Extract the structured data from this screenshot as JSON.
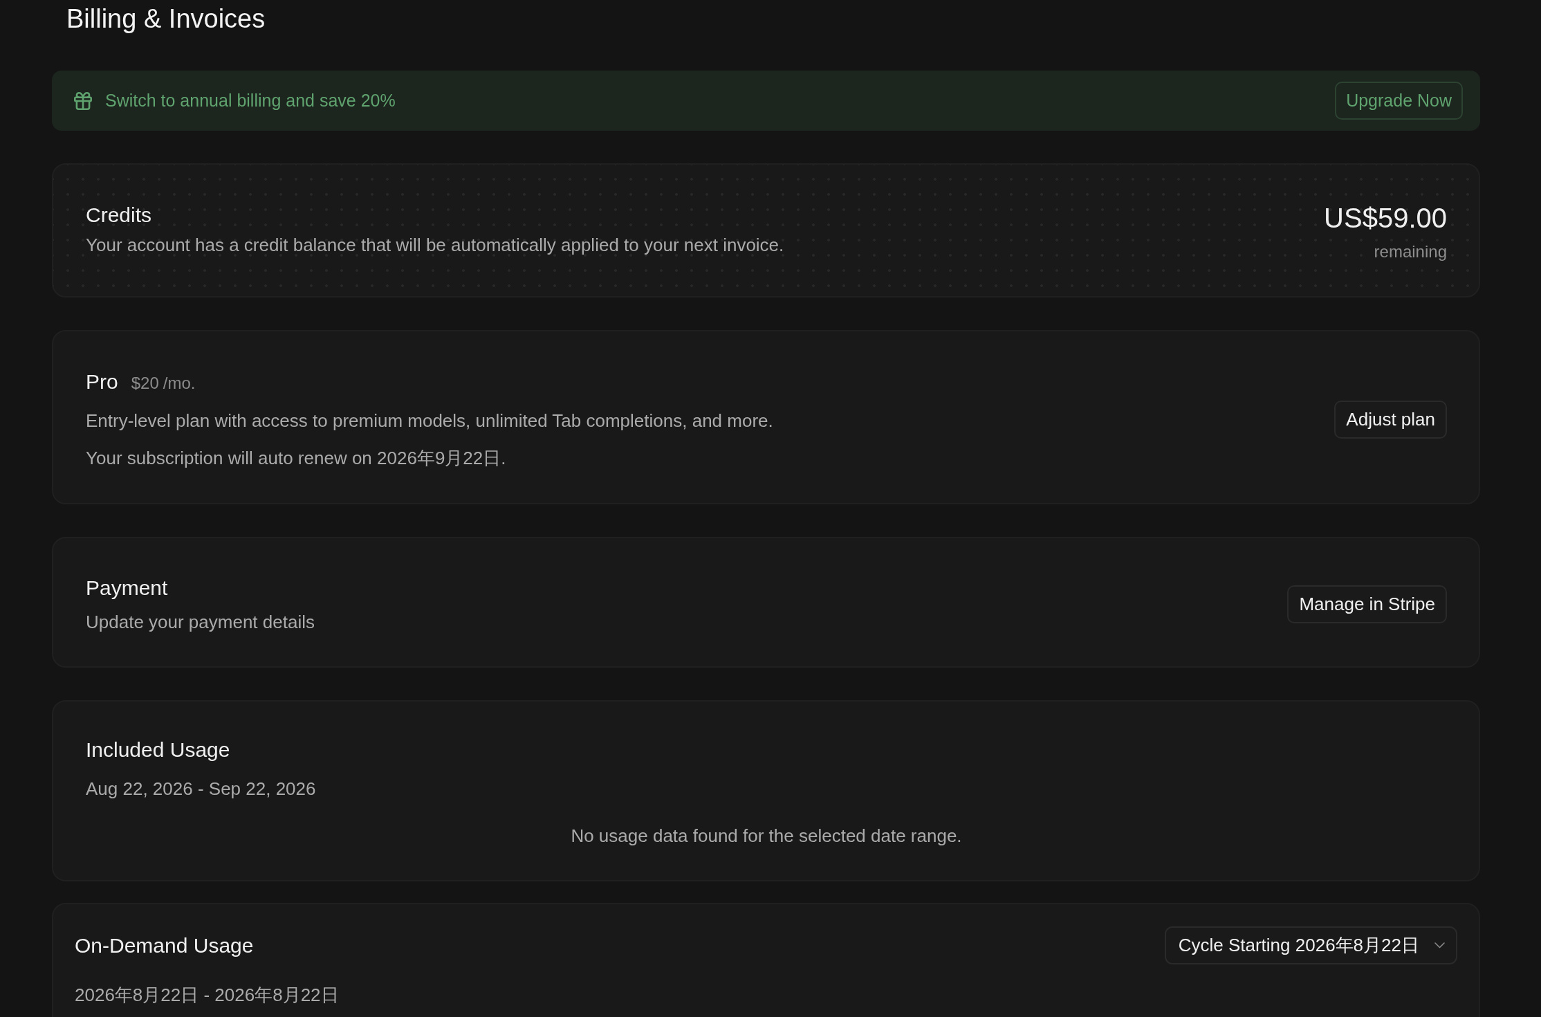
{
  "page": {
    "title": "Billing & Invoices"
  },
  "promo_banner": {
    "text": "Switch to annual billing and save 20%",
    "button": "Upgrade Now"
  },
  "credits": {
    "title": "Credits",
    "description": "Your account has a credit balance that will be automatically applied to your next invoice.",
    "amount": "US$59.00",
    "amount_caption": "remaining"
  },
  "plan": {
    "name": "Pro",
    "price": "$20",
    "period": "/mo.",
    "description": "Entry-level plan with access to premium models, unlimited Tab completions, and more.",
    "renewal": "Your subscription will auto renew on 2026年9月22日.",
    "button": "Adjust plan"
  },
  "payment": {
    "title": "Payment",
    "description": "Update your payment details",
    "button": "Manage in Stripe"
  },
  "included_usage": {
    "title": "Included Usage",
    "date_range": "Aug 22, 2026 - Sep 22, 2026",
    "empty_message": "No usage data found for the selected date range."
  },
  "on_demand_usage": {
    "title": "On-Demand Usage",
    "cycle_select": {
      "value": "Cycle Starting 2026年8月22日"
    },
    "date_range": "2026年8月22日 - 2026年8月22日"
  }
}
